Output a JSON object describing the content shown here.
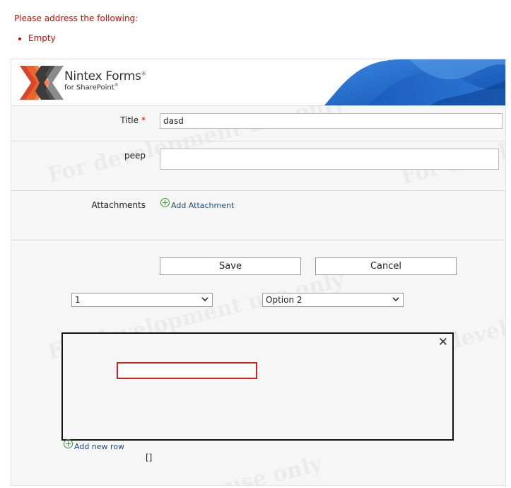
{
  "validation": {
    "heading": "Please address the following:",
    "items": [
      "Empty"
    ]
  },
  "header": {
    "brand_title": "Nintex Forms",
    "brand_mark": "®",
    "brand_subtitle": "for SharePoint",
    "brand_sub_mark": "®"
  },
  "fields": {
    "title": {
      "label": "Title",
      "required_marker": "*",
      "value": "dasd"
    },
    "peep": {
      "label": "peep",
      "value": ""
    },
    "attachments": {
      "label": "Attachments",
      "add_label": "Add Attachment"
    }
  },
  "buttons": {
    "save": "Save",
    "cancel": "Cancel"
  },
  "dropdowns": {
    "first_value": "1",
    "second_value": "Option 2"
  },
  "repeater": {
    "close_glyph": "✕",
    "add_row_label": "Add new row",
    "brackets": "[]"
  },
  "watermark": {
    "text_full": "For development use only",
    "text_part1": "For development",
    "text_part2": "use only",
    "text_part3": "For develo"
  },
  "colors": {
    "error": "#e00000",
    "link": "#1d4a8a",
    "plus": "#3a9a2a",
    "accent_blue": "#1f66c8"
  }
}
